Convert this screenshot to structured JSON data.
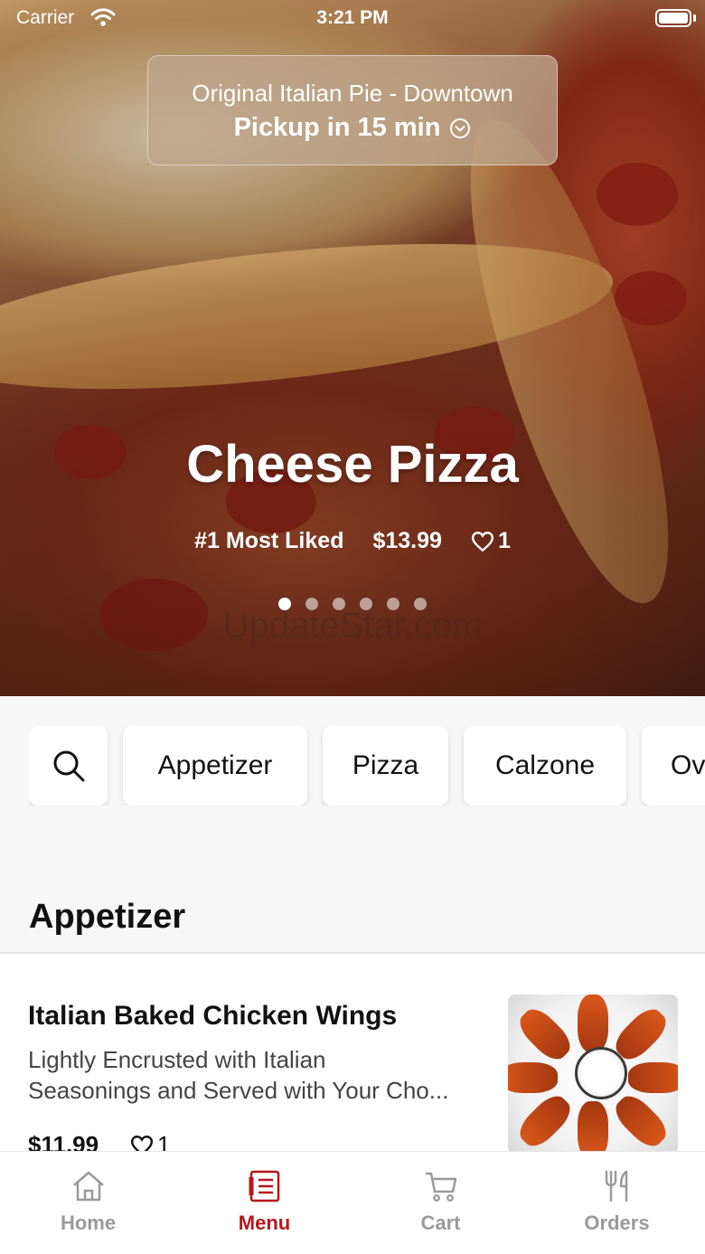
{
  "status_bar": {
    "carrier": "Carrier",
    "time": "3:21 PM"
  },
  "location": {
    "store": "Original Italian Pie - Downtown",
    "pickup": "Pickup in 15 min"
  },
  "featured": {
    "title": "Cheese Pizza",
    "rank": "#1 Most Liked",
    "price": "$13.99",
    "likes": "1",
    "slide_count": 6,
    "active_slide": 1,
    "watermark": "UpdateStar.com"
  },
  "categories": [
    {
      "label": "Appetizer"
    },
    {
      "label": "Pizza"
    },
    {
      "label": "Calzone"
    },
    {
      "label": "Ov"
    }
  ],
  "section": {
    "title": "Appetizer"
  },
  "items": [
    {
      "name": "Italian Baked Chicken Wings",
      "desc_line1": "Lightly Encrusted with Italian",
      "desc_line2": "Seasonings and Served with Your Cho...",
      "price": "$11.99",
      "likes": "1"
    }
  ],
  "tabbar": {
    "home": "Home",
    "menu": "Menu",
    "cart": "Cart",
    "orders": "Orders",
    "active": "menu"
  },
  "colors": {
    "accent": "#b8161c",
    "inactive": "#9a9a9a",
    "background": "#f7f7f7"
  }
}
